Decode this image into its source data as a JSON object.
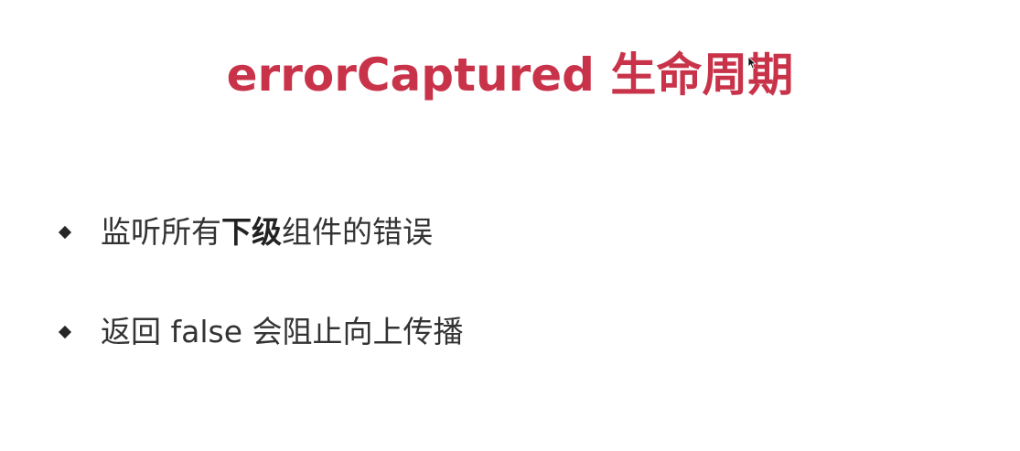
{
  "slide": {
    "title": "errorCaptured 生命周期",
    "bullets": [
      {
        "before": "监听所有",
        "bold": "下级",
        "after": "组件的错误"
      },
      {
        "before": "返回 false 会阻止向上传播",
        "bold": "",
        "after": ""
      }
    ]
  },
  "colors": {
    "title": "#c9334a",
    "text": "#333333",
    "bullet": "#262626"
  },
  "icons": {
    "cursor": "mouse-pointer-icon",
    "bullet": "diamond-bullet-icon"
  }
}
